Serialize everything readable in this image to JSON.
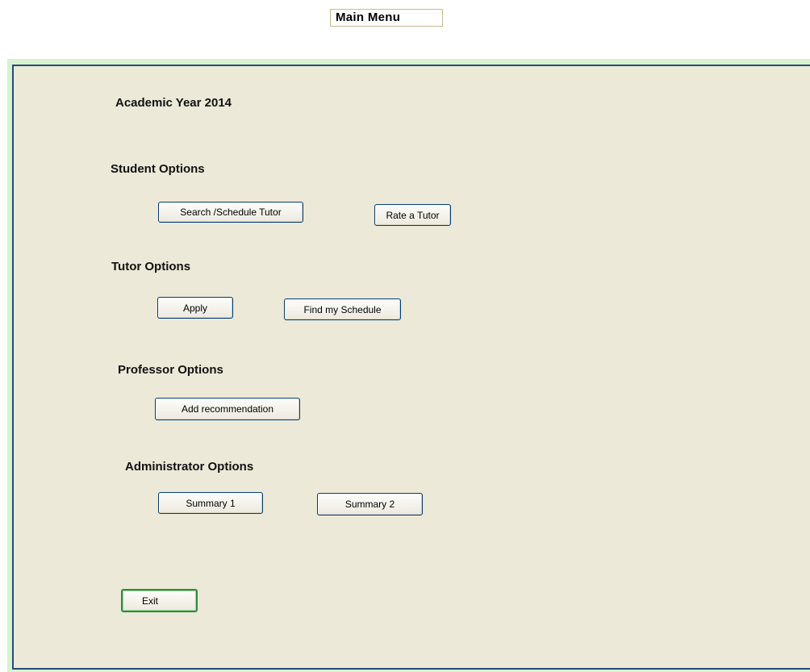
{
  "window": {
    "title": "Main Menu"
  },
  "header": {
    "academic_year": "Academic Year 2014"
  },
  "sections": {
    "student": {
      "title": "Student Options",
      "search_label": "Search /Schedule Tutor",
      "rate_label": "Rate a Tutor"
    },
    "tutor": {
      "title": "Tutor Options",
      "apply_label": "Apply",
      "schedule_label": "Find my Schedule"
    },
    "professor": {
      "title": "Professor Options",
      "recommendation_label": "Add recommendation"
    },
    "administrator": {
      "title": "Administrator Options",
      "summary1_label": "Summary 1",
      "summary2_label": "Summary 2"
    }
  },
  "footer": {
    "exit_label": "Exit"
  },
  "colors": {
    "panel_background": "#ece9d8",
    "panel_border": "#2a4a7a",
    "frame_green": "#d6f3d0",
    "exit_border": "#2f8b3b"
  }
}
